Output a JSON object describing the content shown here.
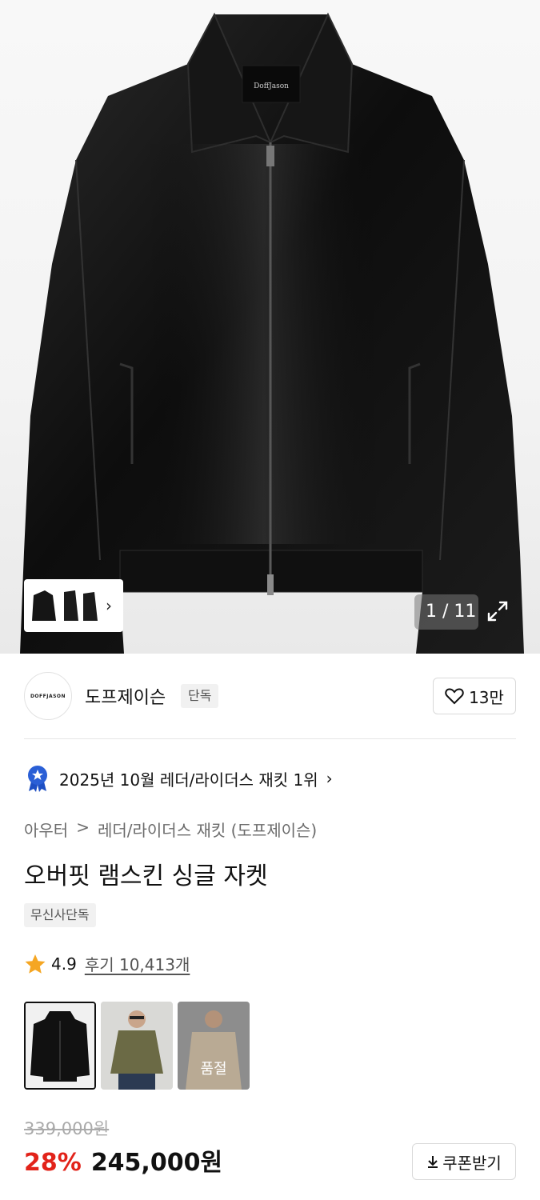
{
  "gallery": {
    "counter": "1 / 11",
    "label_on_jacket": "DoffJason",
    "current_index": 1,
    "total_images": 11
  },
  "brand": {
    "logo_text": "DOFFJASON",
    "name": "도프제이슨",
    "tag": "단독",
    "likes": "13만"
  },
  "ranking": {
    "text": "2025년 10월 레더/라이더스 재킷 1위",
    "badge_color": "#2a5fd6"
  },
  "category": {
    "items": [
      "아우터",
      "레더/라이더스 재킷 (도프제이슨)"
    ],
    "separator": ">"
  },
  "product": {
    "title": "오버핏 램스킨 싱글 자켓",
    "exclusive_tag": "무신사단독",
    "rating": "4.9",
    "reviews": "후기 10,413개",
    "star_color": "#f5a623"
  },
  "options": [
    {
      "name": "black",
      "selected": true,
      "soldout": false,
      "label": ""
    },
    {
      "name": "khaki",
      "selected": false,
      "soldout": false,
      "label": ""
    },
    {
      "name": "beige",
      "selected": false,
      "soldout": true,
      "label": "품절"
    }
  ],
  "price": {
    "original": "339,000원",
    "discount": "28%",
    "sale": "245,000원",
    "discount_color": "#e2231a"
  },
  "coupon": {
    "label": "쿠폰받기"
  }
}
